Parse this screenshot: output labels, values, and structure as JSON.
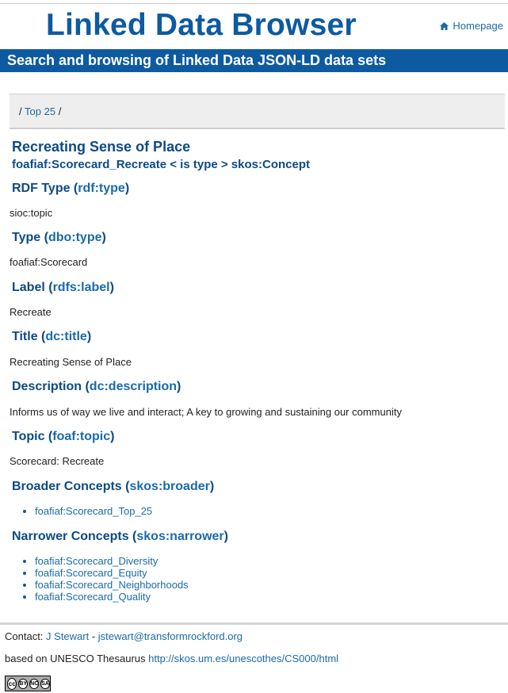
{
  "header": {
    "site_title": "Linked Data Browser",
    "home_label": "Homepage",
    "banner": "Search and browsing of Linked Data JSON-LD data sets"
  },
  "breadcrumb": {
    "sep1": "/",
    "link": "Top 25",
    "sep2": "/"
  },
  "concept": {
    "title": "Recreating Sense of Place",
    "subject_line": "foafiaf:Scorecard_Recreate < is type > skos:Concept"
  },
  "properties": {
    "rdf_type": {
      "label": "RDF Type (",
      "term": "rdf:type",
      "close": ")",
      "value": "sioc:topic"
    },
    "dbo_type": {
      "label": "Type (",
      "term": "dbo:type",
      "close": ")",
      "value": "foafiaf:Scorecard"
    },
    "label": {
      "label": "Label (",
      "term": "rdfs:label",
      "close": ")",
      "value": "Recreate"
    },
    "title": {
      "label": "Title (",
      "term": "dc:title",
      "close": ")",
      "value": "Recreating Sense of Place"
    },
    "description": {
      "label": "Description (",
      "term": "dc:description",
      "close": ")",
      "value": "Informs us of way we live and interact; A key to growing and sustaining our community"
    },
    "topic": {
      "label": "Topic (",
      "term": "foaf:topic",
      "close": ")",
      "value": "Scorecard: Recreate"
    },
    "broader": {
      "label": "Broader Concepts (",
      "term": "skos:broader",
      "close": ")",
      "items": [
        "foafiaf:Scorecard_Top_25"
      ]
    },
    "narrower": {
      "label": "Narrower Concepts (",
      "term": "skos:narrower",
      "close": ")",
      "items": [
        "foafiaf:Scorecard_Diversity",
        "foafiaf:Scorecard_Equity",
        "foafiaf:Scorecard_Neighborhoods",
        "foafiaf:Scorecard_Quality"
      ]
    }
  },
  "footer": {
    "contact_prefix": "Contact: ",
    "contact_name": "J Stewart",
    "contact_sep": " - ",
    "contact_email": "jstewart@transformrockford.org",
    "based_prefix": "based on UNESCO Thesaurus ",
    "based_link": "http://skos.um.es/unescothes/CS000/html",
    "license_badge": {
      "cc": "cc",
      "by": "BY",
      "nc": "NC",
      "sa": "SA"
    }
  },
  "colors": {
    "brand": "#0d5aa1",
    "heading": "#0d4a85",
    "link": "#1a6aa8"
  }
}
